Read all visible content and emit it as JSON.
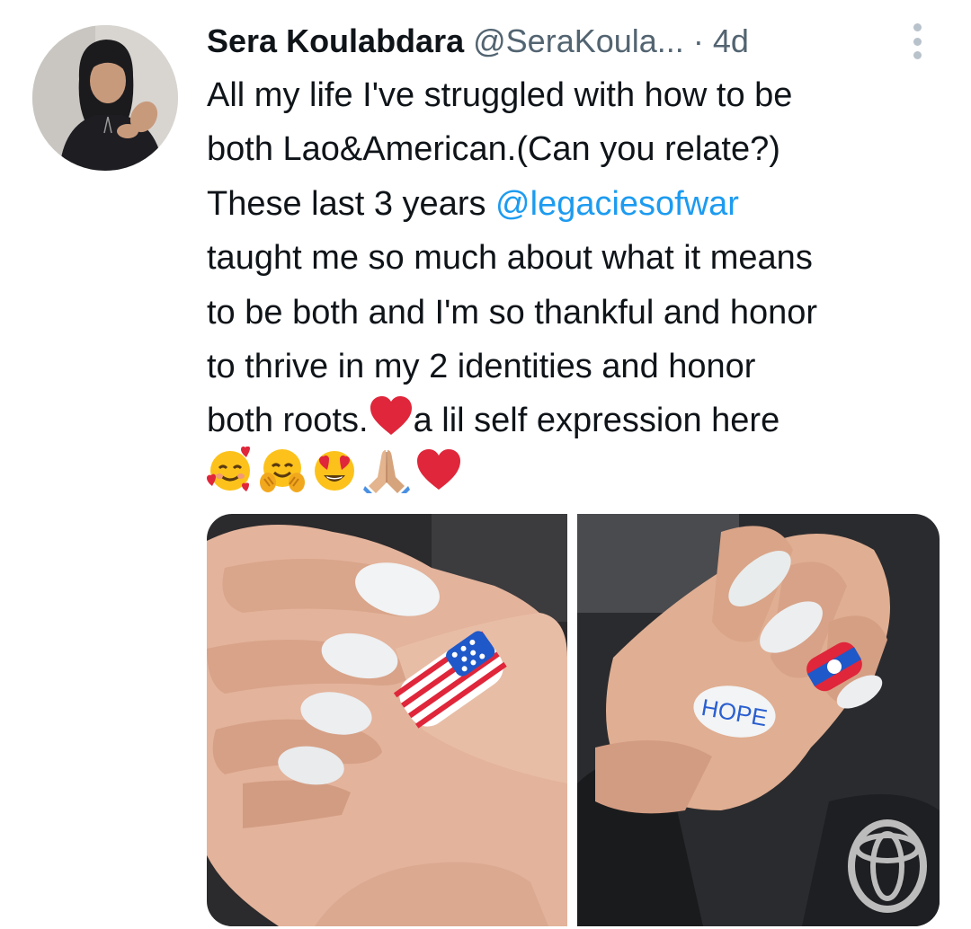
{
  "tweet": {
    "author_name": "Sera Koulabdara",
    "handle": "@SeraKoula...",
    "separator": "·",
    "time": "4d",
    "text_lines": {
      "l1": "All my life I've struggled with how to be",
      "l2": "both Lao&American.(Can you relate?)",
      "l3_pre": "These last 3 years ",
      "l3_mention": "@legaciesofwar",
      "l4": "taught me so much about what it means",
      "l5": "to be both and I'm so thankful and honor",
      "l6": "to thrive in my 2 identities and honor",
      "l7_pre": "both roots.",
      "l7_post": "a lil self expression here"
    },
    "emojis": [
      "smiling-face-with-hearts",
      "hugging-face",
      "heart-eyes-face",
      "folded-hands",
      "red-heart"
    ],
    "media": {
      "left_nail_text": "",
      "right_nail_text": "HOPE"
    }
  },
  "colors": {
    "text": "#0f1419",
    "secondary": "#536471",
    "link": "#1d9bf0",
    "heart": "#e0263a"
  }
}
